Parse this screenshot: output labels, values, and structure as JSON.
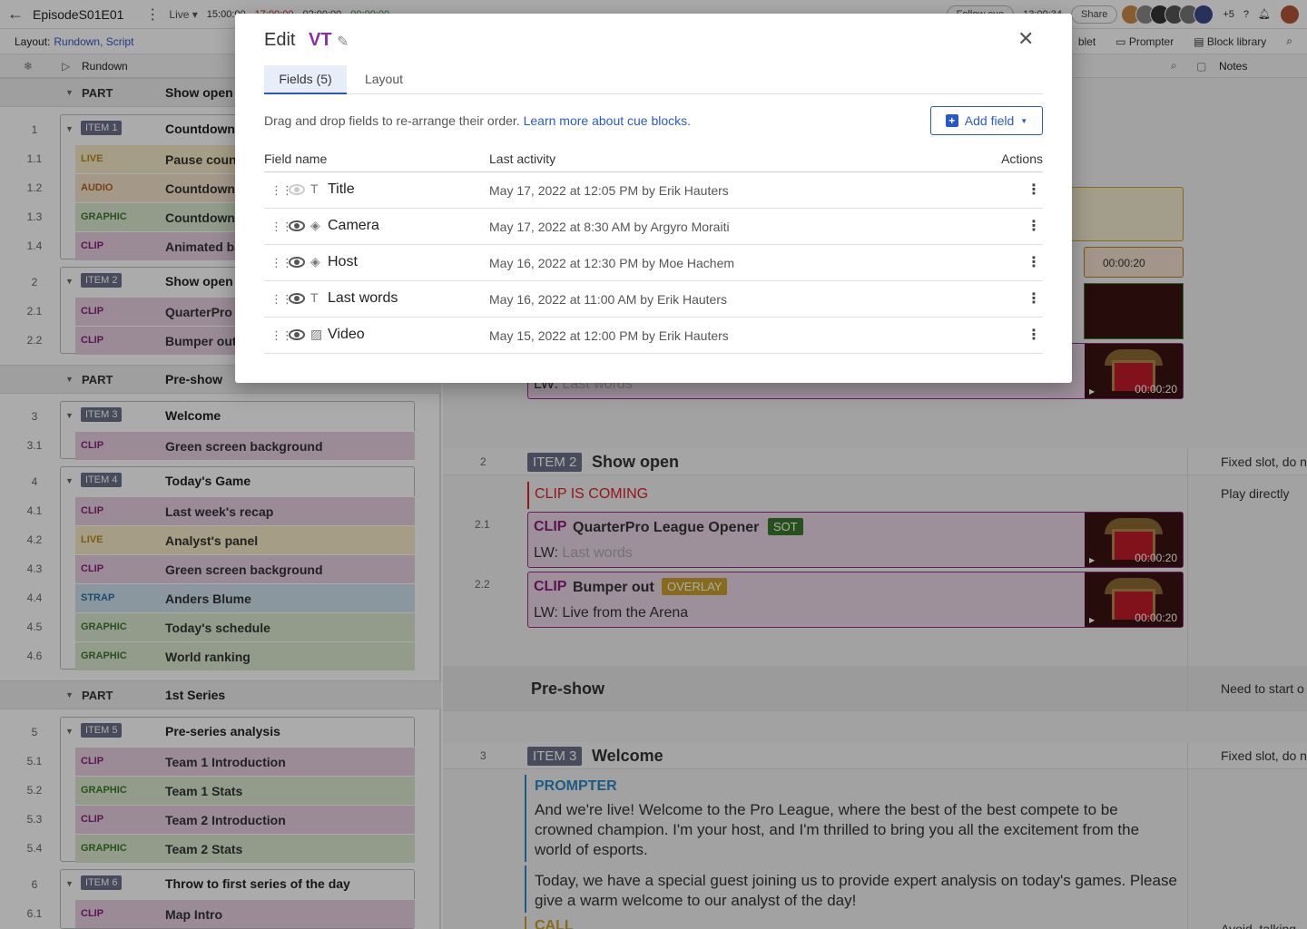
{
  "topbar": {
    "episode": "EpisodeS01E01",
    "mode": "Live",
    "times": [
      "15:00:00",
      "17:00:00",
      "02:00:00",
      "00:00:00"
    ],
    "follow": "Follow cue",
    "clock": "13:09:34",
    "share": "Share",
    "more_users": "+5"
  },
  "toolbar": {
    "layout_label": "Layout:",
    "layout_value": "Rundown, Script",
    "tablet": "blet",
    "prompter": "Prompter",
    "block_library": "Block library"
  },
  "columns": {
    "rundown": "Rundown",
    "notes": "Notes"
  },
  "rundown": {
    "parts": [
      {
        "label": "PART",
        "title": "Show open"
      },
      {
        "label": "PART",
        "title": "Pre-show"
      },
      {
        "label": "PART",
        "title": "1st Series"
      }
    ],
    "items": [
      {
        "num": "1",
        "badge": "ITEM 1",
        "title": "Countdown",
        "cues": [
          {
            "num": "1.1",
            "type": "LIVE",
            "title": "Pause count"
          },
          {
            "num": "1.2",
            "type": "AUDIO",
            "title": "Countdown"
          },
          {
            "num": "1.3",
            "type": "GRAPHIC",
            "title": "Countdown"
          },
          {
            "num": "1.4",
            "type": "CLIP",
            "title": "Animated ba"
          }
        ]
      },
      {
        "num": "2",
        "badge": "ITEM 2",
        "title": "Show open",
        "cues": [
          {
            "num": "2.1",
            "type": "CLIP",
            "title": "QuarterPro"
          },
          {
            "num": "2.2",
            "type": "CLIP",
            "title": "Bumper out"
          }
        ]
      },
      {
        "num": "3",
        "badge": "ITEM 3",
        "title": "Welcome",
        "cues": [
          {
            "num": "3.1",
            "type": "CLIP",
            "title": "Green screen background"
          }
        ]
      },
      {
        "num": "4",
        "badge": "ITEM 4",
        "title": "Today's Game",
        "cues": [
          {
            "num": "4.1",
            "type": "CLIP",
            "title": "Last week's recap"
          },
          {
            "num": "4.2",
            "type": "LIVE",
            "title": "Analyst's panel"
          },
          {
            "num": "4.3",
            "type": "CLIP",
            "title": "Green screen background"
          },
          {
            "num": "4.4",
            "type": "STRAP",
            "title": "Anders Blume"
          },
          {
            "num": "4.5",
            "type": "GRAPHIC",
            "title": "Today's schedule"
          },
          {
            "num": "4.6",
            "type": "GRAPHIC",
            "title": "World ranking"
          }
        ]
      },
      {
        "num": "5",
        "badge": "ITEM 5",
        "title": "Pre-series analysis",
        "cues": [
          {
            "num": "5.1",
            "type": "CLIP",
            "title": "Team 1 Introduction"
          },
          {
            "num": "5.2",
            "type": "GRAPHIC",
            "title": "Team 1 Stats"
          },
          {
            "num": "5.3",
            "type": "CLIP",
            "title": "Team 2 Introduction"
          },
          {
            "num": "5.4",
            "type": "GRAPHIC",
            "title": "Team 2 Stats"
          }
        ]
      },
      {
        "num": "6",
        "badge": "ITEM 6",
        "title": "Throw to first series of the day",
        "cues": [
          {
            "num": "6.1",
            "type": "CLIP",
            "title": "Map Intro"
          }
        ]
      }
    ]
  },
  "script": {
    "lw_prefix": "LW:",
    "placeholder_lw": "Last words",
    "dur": "00:00:20",
    "item2": {
      "num": "2",
      "badge": "ITEM 2",
      "title": "Show open",
      "note": "Fixed slot, do n"
    },
    "clip_coming": "CLIP IS COMING",
    "clip_coming_note": "Play directly",
    "cue21": {
      "num": "2.1",
      "kind": "CLIP",
      "title": "QuarterPro League Opener",
      "tag": "SOT",
      "lw": "Last words"
    },
    "cue22": {
      "num": "2.2",
      "kind": "CLIP",
      "title": "Bumper out",
      "tag": "OVERLAY",
      "lw": "Live from the Arena"
    },
    "preshow": {
      "title": "Pre-show",
      "note": "Need to start o"
    },
    "item3": {
      "num": "3",
      "badge": "ITEM 3",
      "title": "Welcome",
      "note": "Fixed slot, do n"
    },
    "prompter_label": "PROMPTER",
    "prompter_p1": "And we're live! Welcome to the Pro League, where the best of the best compete to be crowned champion. I'm your host, and I'm thrilled to bring you all the excitement from the world of esports.",
    "prompter_p2": "Today, we have a special guest joining us to provide expert analysis on today's games. Please give a warm welcome to our analyst of the day!",
    "call_label": "CALL",
    "bottom_note": "Avoid, talking"
  },
  "modal": {
    "title": "Edit",
    "cue_type": "VT",
    "tabs": [
      "Fields (5)",
      "Layout"
    ],
    "hint": "Drag and drop fields to re-arrange their order.",
    "learn_more": "Learn more about cue blocks.",
    "add_field": "Add field",
    "col_name": "Field name",
    "col_activity": "Last activity",
    "col_actions": "Actions",
    "fields": [
      {
        "name": "Title",
        "type_icon": "text-icon",
        "visible": false,
        "activity": "May 17, 2022 at 12:05 PM by Erik Hauters"
      },
      {
        "name": "Camera",
        "type_icon": "tag-icon",
        "visible": true,
        "activity": "May 17, 2022 at 8:30 AM by Argyro Moraiti"
      },
      {
        "name": "Host",
        "type_icon": "tag-icon",
        "visible": true,
        "activity": "May 16, 2022 at 12:30 PM by Moe Hachem"
      },
      {
        "name": "Last words",
        "type_icon": "text-icon",
        "visible": true,
        "activity": "May 16, 2022 at 11:00 AM by Erik Hauters"
      },
      {
        "name": "Video",
        "type_icon": "image-icon",
        "visible": true,
        "activity": "May 15, 2022 at 12:00 PM by Erik Hauters"
      }
    ]
  }
}
